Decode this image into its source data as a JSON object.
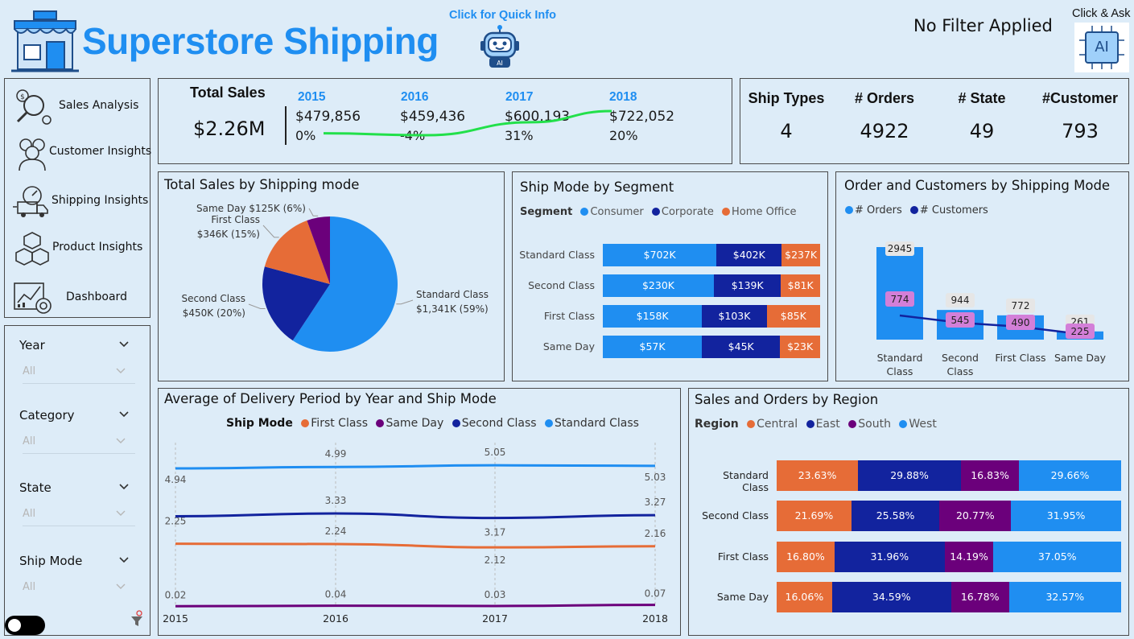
{
  "header": {
    "title": "Superstore Shipping",
    "quick_info": "Click for Quick Info",
    "filter_status": "No Filter Applied",
    "click_ask": "Click & Ask",
    "ai_label": "AI"
  },
  "nav": {
    "items": [
      {
        "label": "Sales Analysis",
        "icon": "magnifier-dollar-icon"
      },
      {
        "label": "Customer Insights",
        "icon": "customers-icon"
      },
      {
        "label": "Shipping Insights",
        "icon": "delivery-truck-icon"
      },
      {
        "label": "Product Insights",
        "icon": "boxes-icon"
      },
      {
        "label": "Dashboard",
        "icon": "dashboard-icon"
      }
    ]
  },
  "slicers": [
    {
      "label": "Year",
      "value": "All"
    },
    {
      "label": "Category",
      "value": "All"
    },
    {
      "label": "State",
      "value": "All"
    },
    {
      "label": "Ship Mode",
      "value": "All"
    }
  ],
  "kpi": {
    "total_label": "Total Sales",
    "total_value": "$2.26M",
    "years": [
      {
        "year": "2015",
        "sales": "$479,856",
        "growth": "0%"
      },
      {
        "year": "2016",
        "sales": "$459,436",
        "growth": "-4%"
      },
      {
        "year": "2017",
        "sales": "$600,193",
        "growth": "31%"
      },
      {
        "year": "2018",
        "sales": "$722,052",
        "growth": "20%"
      }
    ],
    "sparkline_color": "#22e04a"
  },
  "stats": [
    {
      "label": "Ship Types",
      "value": "4"
    },
    {
      "label": "# Orders",
      "value": "4922"
    },
    {
      "label": "# State",
      "value": "49"
    },
    {
      "label": "#Customer",
      "value": "793"
    }
  ],
  "colors": {
    "consumer": "#1f8ef1",
    "corporate": "#12239e",
    "home_office": "#e66c37",
    "same_day": "#6b007b",
    "line_orders": "#1f8ef1",
    "line_customers": "#12239e",
    "label_pink": "#d37fd8"
  },
  "chart_data": [
    {
      "type": "pie",
      "title": "Total Sales by Shipping mode",
      "slices": [
        {
          "label": "Standard Class",
          "value": 1341,
          "display": "$1,341K (59%)"
        },
        {
          "label": "Second Class",
          "value": 450,
          "display": "$450K (20%)"
        },
        {
          "label": "First Class",
          "value": 346,
          "display": "$346K (15%)"
        },
        {
          "label": "Same Day",
          "value": 125,
          "display": "$125K (6%)"
        }
      ],
      "colors": [
        "#1f8ef1",
        "#12239e",
        "#e66c37",
        "#6b007b"
      ]
    },
    {
      "type": "bar",
      "orientation": "horizontal-stacked",
      "title": "Ship Mode by Segment",
      "legend_title": "Segment",
      "categories": [
        "Standard Class",
        "Second Class",
        "First Class",
        "Same Day"
      ],
      "series": [
        {
          "name": "Consumer",
          "values": [
            702,
            230,
            158,
            57
          ],
          "labels": [
            "$702K",
            "$230K",
            "$158K",
            "$57K"
          ]
        },
        {
          "name": "Corporate",
          "values": [
            402,
            139,
            103,
            45
          ],
          "labels": [
            "$402K",
            "$139K",
            "$103K",
            "$45K"
          ]
        },
        {
          "name": "Home Office",
          "values": [
            237,
            81,
            85,
            23
          ],
          "labels": [
            "$237K",
            "$81K",
            "$85K",
            "$23K"
          ]
        }
      ]
    },
    {
      "type": "bar",
      "title": "Order and Customers by Shipping Mode",
      "categories": [
        "Standard Class",
        "Second Class",
        "First Class",
        "Same Day"
      ],
      "category_lines": [
        [
          "Standard",
          "Class"
        ],
        [
          "Second",
          "Class"
        ],
        [
          "First Class"
        ],
        [
          "Same Day"
        ]
      ],
      "series": [
        {
          "name": "# Orders",
          "kind": "bar",
          "values": [
            2945,
            944,
            772,
            261
          ]
        },
        {
          "name": "# Customers",
          "kind": "line",
          "values": [
            774,
            545,
            490,
            225
          ]
        }
      ]
    },
    {
      "type": "line",
      "title": "Average of Delivery Period by Year and Ship Mode",
      "legend_title": "Ship Mode",
      "x": [
        "2015",
        "2016",
        "2017",
        "2018"
      ],
      "series": [
        {
          "name": "First Class",
          "values": [
            2.25,
            2.24,
            2.12,
            2.16
          ]
        },
        {
          "name": "Same Day",
          "values": [
            0.02,
            0.04,
            0.03,
            0.07
          ]
        },
        {
          "name": "Second Class",
          "values": [
            3.23,
            3.33,
            3.17,
            3.27
          ]
        },
        {
          "name": "Standard Class",
          "values": [
            4.94,
            4.99,
            5.05,
            5.03
          ]
        }
      ],
      "value_labels": {
        "Standard Class": [
          "4.94",
          "4.99",
          "5.05",
          "5.03"
        ],
        "Second Class": [
          "",
          "3.33",
          "3.17",
          "3.27"
        ],
        "First Class": [
          "2.25",
          "2.24",
          "2.12",
          "2.16"
        ],
        "Same Day": [
          "0.02",
          "0.04",
          "0.03",
          "0.07"
        ]
      },
      "ylim": [
        0,
        5.6
      ]
    },
    {
      "type": "bar",
      "orientation": "horizontal-100pct-stacked",
      "title": "Sales and Orders by Region",
      "legend_title": "Region",
      "categories": [
        "Standard Class",
        "Second Class",
        "First Class",
        "Same Day"
      ],
      "series": [
        {
          "name": "Central",
          "values": [
            23.63,
            21.69,
            16.8,
            16.06
          ],
          "labels": [
            "23.63%",
            "21.69%",
            "16.80%",
            "16.06%"
          ]
        },
        {
          "name": "East",
          "values": [
            29.88,
            25.58,
            31.96,
            34.59
          ],
          "labels": [
            "29.88%",
            "25.58%",
            "31.96%",
            "34.59%"
          ]
        },
        {
          "name": "South",
          "values": [
            16.83,
            20.77,
            14.19,
            16.78
          ],
          "labels": [
            "16.83%",
            "20.77%",
            "14.19%",
            "16.78%"
          ]
        },
        {
          "name": "West",
          "values": [
            29.66,
            31.95,
            37.05,
            32.57
          ],
          "labels": [
            "29.66%",
            "31.95%",
            "37.05%",
            "32.57%"
          ]
        }
      ]
    }
  ]
}
